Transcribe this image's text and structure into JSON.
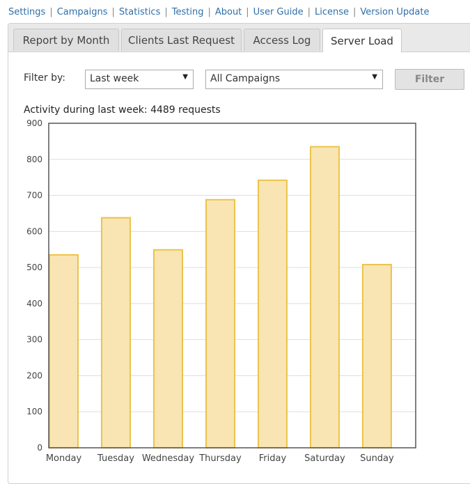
{
  "nav": {
    "items": [
      "Settings",
      "Campaigns",
      "Statistics",
      "Testing",
      "About",
      "User Guide",
      "License",
      "Version Update"
    ]
  },
  "tabs": [
    {
      "label": "Report by Month",
      "active": false
    },
    {
      "label": "Clients Last Request",
      "active": false
    },
    {
      "label": "Access Log",
      "active": false
    },
    {
      "label": "Server Load",
      "active": true
    }
  ],
  "filter": {
    "label": "Filter by:",
    "period": "Last week",
    "campaign": "All Campaigns",
    "button": "Filter"
  },
  "activity_text": "Activity during last week: 4489 requests",
  "colors": {
    "link": "#2f6fa8",
    "bar_fill": "#f8e5b3",
    "bar_stroke": "#ecc34a"
  },
  "chart_data": {
    "type": "bar",
    "title": "",
    "categories": [
      "Monday",
      "Tuesday",
      "Wednesday",
      "Thursday",
      "Friday",
      "Saturday",
      "Sunday"
    ],
    "values": [
      535,
      638,
      549,
      688,
      742,
      835,
      508
    ],
    "ylim": [
      0,
      900
    ],
    "yticks": [
      0,
      100,
      200,
      300,
      400,
      500,
      600,
      700,
      800,
      900
    ],
    "grid": true
  }
}
